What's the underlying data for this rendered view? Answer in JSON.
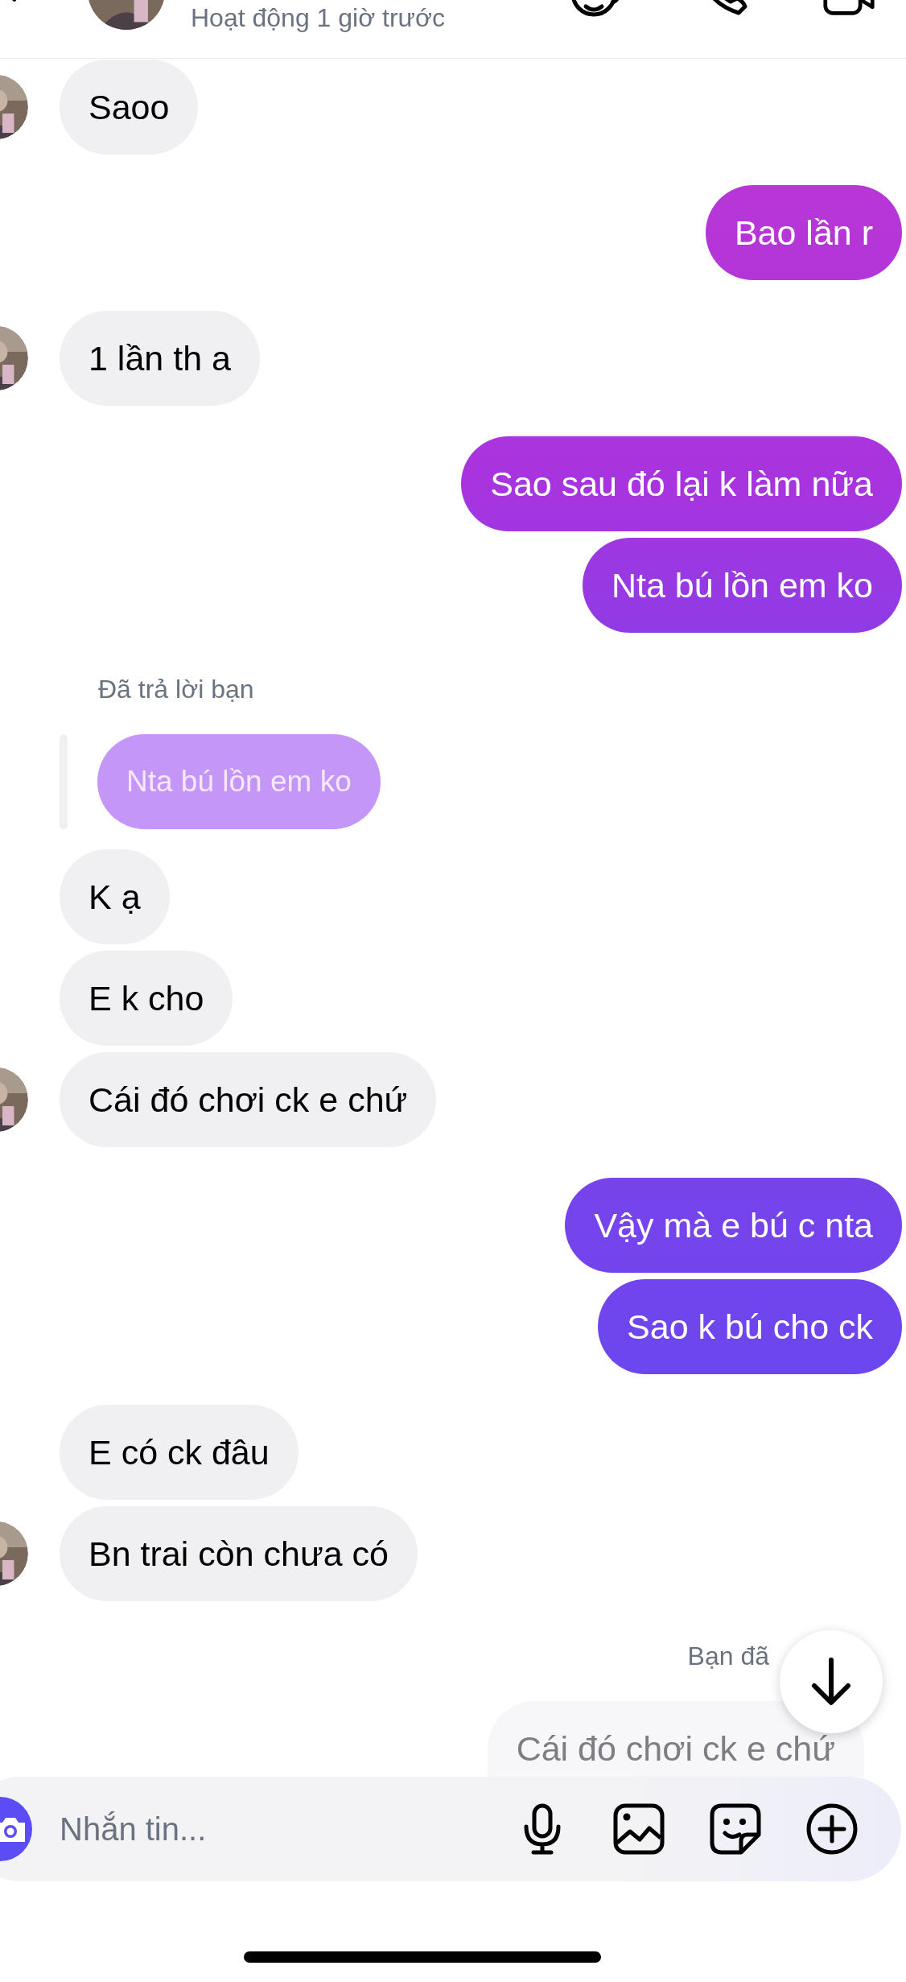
{
  "header": {
    "status": "Hoạt động 1 giờ trước"
  },
  "messages": [
    {
      "kind": "received",
      "text": "Saoo",
      "avatar": true
    },
    {
      "kind": "sent",
      "text": "Bao lần r"
    },
    {
      "kind": "received",
      "text": "1 lần th a",
      "avatar": true
    },
    {
      "kind": "sent",
      "text": "Sao sau đó lại k làm nữa"
    },
    {
      "kind": "sent",
      "text": "Nta bú lồn em ko"
    },
    {
      "kind": "reply_label",
      "text": "Đã trả lời bạn"
    },
    {
      "kind": "reply_quote",
      "text": "Nta bú lồn em ko"
    },
    {
      "kind": "received",
      "text": "K ạ",
      "avatar": false
    },
    {
      "kind": "received",
      "text": "E k cho",
      "avatar": false
    },
    {
      "kind": "received",
      "text": "Cái đó chơi ck e chứ",
      "avatar": true
    },
    {
      "kind": "sent",
      "text": "Vậy mà e bú c nta"
    },
    {
      "kind": "sent",
      "text": "Sao k bú cho ck"
    },
    {
      "kind": "received",
      "text": "E có ck đâu",
      "avatar": false
    },
    {
      "kind": "received",
      "text": "Bn trai còn chưa có",
      "avatar": true
    },
    {
      "kind": "seen_label",
      "text": "Bạn đã"
    },
    {
      "kind": "preview",
      "text": "Cái đó chơi ck e chứ"
    }
  ],
  "composer": {
    "placeholder": "Nhắn tin..."
  }
}
